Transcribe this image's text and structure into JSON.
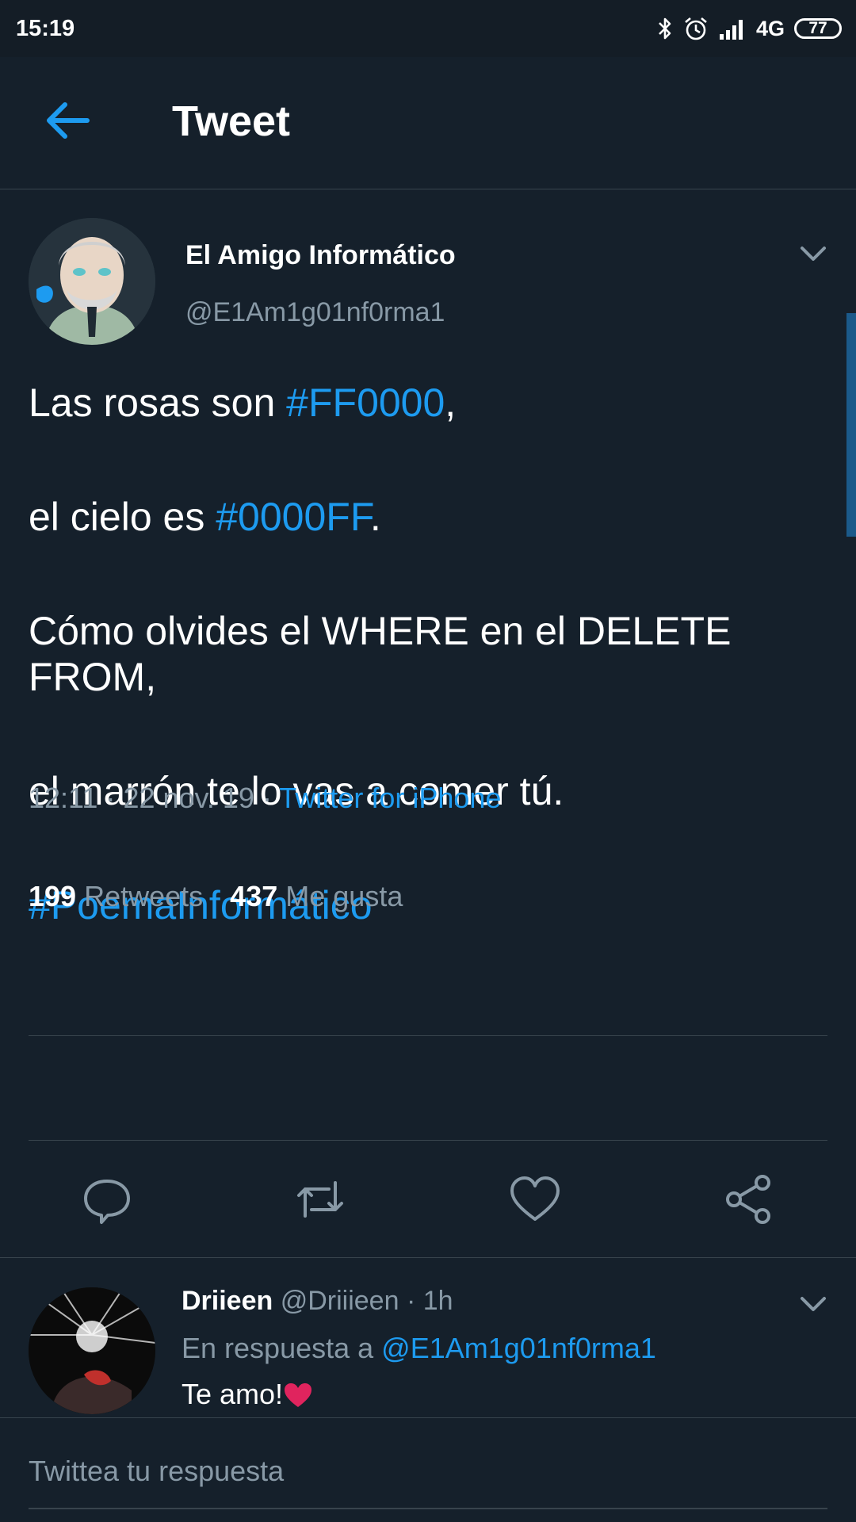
{
  "status_bar": {
    "time": "15:19",
    "network": "4G",
    "battery": "77",
    "icons": [
      "bluetooth-icon",
      "alarm-icon",
      "signal-icon"
    ]
  },
  "header": {
    "title": "Tweet",
    "back_icon": "arrow-left-icon"
  },
  "tweet": {
    "author": {
      "name": "El Amigo Informático",
      "handle": "@E1Am1g01nf0rma1"
    },
    "body": {
      "line1_prefix": "Las rosas son ",
      "line1_tag": "#FF0000",
      "line1_suffix": ",",
      "line2_prefix": "el cielo es ",
      "line2_tag": "#0000FF",
      "line2_suffix": ".",
      "line3": "Cómo olvides el WHERE en el DELETE FROM,",
      "line4": "el marrón te lo vas a comer tú.",
      "hashtag": "#PoemaInformático"
    },
    "meta": {
      "time": "12:11",
      "date": "22 nov. 19",
      "separator": "·",
      "source": "Twitter for iPhone"
    },
    "stats": {
      "retweets_count": "199",
      "retweets_label": "Retweets",
      "likes_count": "437",
      "likes_label": "Me gusta"
    },
    "actions": [
      "reply-icon",
      "retweet-icon",
      "like-icon",
      "share-icon"
    ]
  },
  "reply": {
    "name": "Driieen",
    "handle": "@Driiieen",
    "separator": "·",
    "time": "1h",
    "in_reply_prefix": "En respuesta a",
    "in_reply_handle": "@E1Am1g01nf0rma1",
    "text": "Te amo!",
    "emoji": "heart-icon"
  },
  "compose": {
    "placeholder": "Twittea tu respuesta"
  },
  "colors": {
    "background": "#15202b",
    "accent": "#1d9bf0",
    "secondary_text": "#8899a6",
    "divider": "#38444d",
    "heart": "#e0245e"
  }
}
